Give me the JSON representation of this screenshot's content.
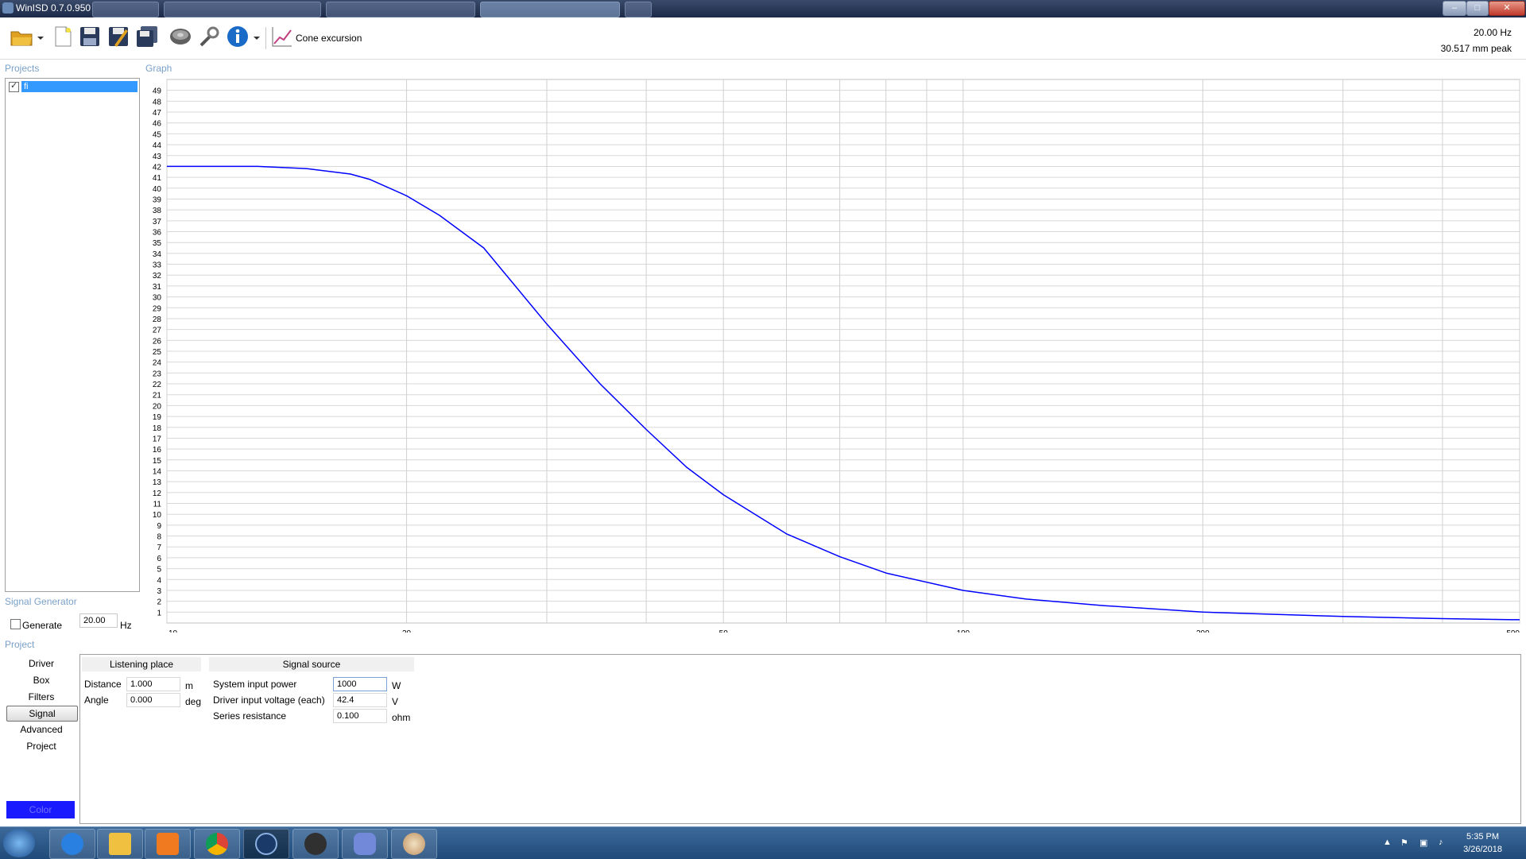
{
  "window": {
    "title": "WinISD 0.7.0.950"
  },
  "toolbar": {
    "cone_label": "Cone excursion",
    "readout_freq": "20.00 Hz",
    "readout_value": "30.517 mm peak",
    "icons": [
      "open-folder-icon",
      "new-document-icon",
      "save-icon",
      "save-as-icon",
      "save-all-icon",
      "driver-icon",
      "wrench-icon",
      "info-icon",
      "graph-icon"
    ]
  },
  "sections": {
    "projects": "Projects",
    "graph": "Graph",
    "signal_generator": "Signal Generator",
    "project": "Project"
  },
  "projects": {
    "items": [
      {
        "name": "fi",
        "checked": true
      }
    ]
  },
  "signal_generator": {
    "generate_label": "Generate",
    "frequency": "20.00",
    "unit": "Hz"
  },
  "project_nav": {
    "items": [
      "Driver",
      "Box",
      "Filters",
      "Signal",
      "Advanced",
      "Project"
    ],
    "active": "Signal",
    "color_label": "Color",
    "color": "#1a1aff"
  },
  "listening_place": {
    "header": "Listening place",
    "distance_label": "Distance",
    "distance_value": "1.000",
    "distance_unit": "m",
    "angle_label": "Angle",
    "angle_value": "0.000",
    "angle_unit": "deg"
  },
  "signal_source": {
    "header": "Signal source",
    "power_label": "System input power",
    "power_value": "1000",
    "power_unit": "W",
    "voltage_label": "Driver input voltage (each)",
    "voltage_value": "42.4",
    "voltage_unit": "V",
    "resistance_label": "Series resistance",
    "resistance_value": "0.100",
    "resistance_unit": "ohm"
  },
  "taskbar": {
    "time": "5:35 PM",
    "date": "3/26/2018",
    "apps": [
      "internet-explorer-icon",
      "file-explorer-icon",
      "media-player-icon",
      "chrome-icon",
      "app-icon",
      "audio-app-icon",
      "discord-icon",
      "paint-icon"
    ]
  },
  "chart_data": {
    "type": "line",
    "x_scale": "log",
    "xlim": [
      10,
      500
    ],
    "ylim": [
      0,
      50
    ],
    "x_ticks": [
      10,
      20,
      50,
      100,
      200,
      500
    ],
    "y_ticks": [
      1,
      2,
      3,
      4,
      5,
      6,
      7,
      8,
      9,
      10,
      11,
      12,
      13,
      14,
      15,
      16,
      17,
      18,
      19,
      20,
      21,
      22,
      23,
      24,
      25,
      26,
      27,
      28,
      29,
      30,
      31,
      32,
      33,
      34,
      35,
      36,
      37,
      38,
      39,
      40,
      41,
      42,
      43,
      44,
      45,
      46,
      47,
      48,
      49
    ],
    "grid": true,
    "series": [
      {
        "color": "#0000ff",
        "x": [
          10,
          13,
          15,
          17,
          18,
          20,
          22,
          25,
          30,
          35,
          40,
          45,
          50,
          60,
          70,
          80,
          100,
          120,
          150,
          200,
          300,
          400,
          500
        ],
        "y": [
          42,
          42,
          41.8,
          41.3,
          40.8,
          39.3,
          37.5,
          34.5,
          27.5,
          22.0,
          17.8,
          14.3,
          11.8,
          8.2,
          6.1,
          4.6,
          3.0,
          2.2,
          1.6,
          1.0,
          0.6,
          0.4,
          0.3
        ]
      }
    ]
  }
}
